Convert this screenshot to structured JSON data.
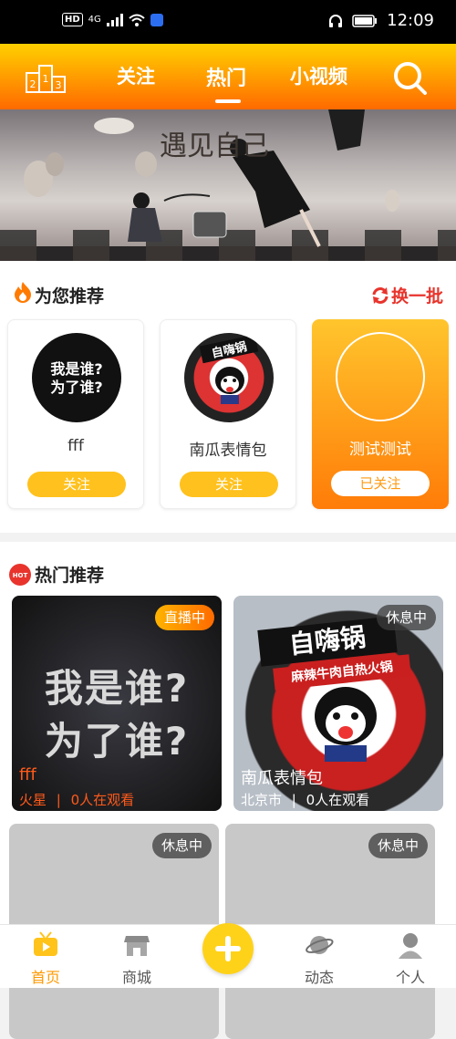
{
  "status": {
    "network": "4G",
    "time": "12:09"
  },
  "nav": {
    "tabs": [
      "关注",
      "热门",
      "小视频"
    ],
    "active": "热门",
    "rank_digits": [
      "2",
      "1",
      "3"
    ]
  },
  "banner": {
    "title_art": "遇见自己"
  },
  "recommend": {
    "title": "为您推荐",
    "refresh": "换一批",
    "items": [
      {
        "name": "fff",
        "avatar_text": "我是谁?为了谁?",
        "button": "关注"
      },
      {
        "name": "南瓜表情包",
        "avatar_text": "自嗨锅",
        "button": "关注"
      },
      {
        "name": "测试测试",
        "button": "已关注"
      }
    ]
  },
  "hot": {
    "title": "热门推荐",
    "hot_badge": "HOT",
    "items": [
      {
        "tag": "直播中",
        "name": "fff",
        "location": "火星",
        "viewers": "0人在观看",
        "art_line1": "我是谁?",
        "art_line2": "为了谁?"
      },
      {
        "tag": "休息中",
        "name": "南瓜表情包",
        "location": "北京市",
        "viewers": "0人在观看",
        "art_text": "自嗨锅",
        "art_sub": "麻辣牛肉自热火锅"
      },
      {
        "tag": "休息中"
      },
      {
        "tag": "休息中"
      }
    ]
  },
  "tabbar": {
    "items": [
      "首页",
      "商城",
      "动态",
      "个人"
    ],
    "active": "首页"
  },
  "colors": {
    "accent": "#ff9900",
    "header_top": "#ffd000",
    "header_bottom": "#ff6a00",
    "refresh": "#e8342c"
  }
}
